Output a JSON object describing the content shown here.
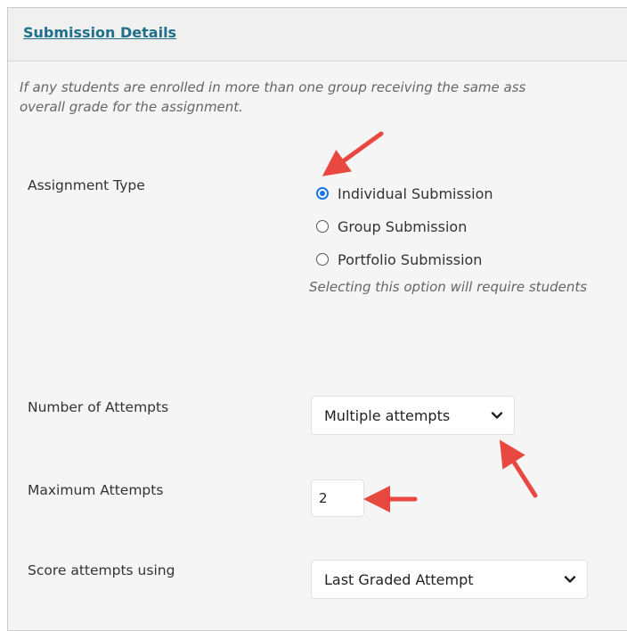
{
  "panel": {
    "title": "Submission Details",
    "intro_line1": "If any students are enrolled in more than one group receiving the same ass",
    "intro_line2": "overall grade for the assignment."
  },
  "assignment_type": {
    "label": "Assignment Type",
    "options": [
      {
        "label": "Individual Submission",
        "checked": true
      },
      {
        "label": "Group Submission",
        "checked": false
      },
      {
        "label": "Portfolio Submission",
        "checked": false
      }
    ],
    "helper": "Selecting this option will require students"
  },
  "attempts": {
    "label": "Number of Attempts",
    "selected": "Multiple attempts"
  },
  "max_attempts": {
    "label": "Maximum Attempts",
    "value": "2"
  },
  "score_using": {
    "label": "Score attempts using",
    "selected": "Last Graded Attempt"
  },
  "colors": {
    "title": "#1f6f8b",
    "radio_accent": "#1a73e8",
    "annotation_arrow": "#e8483f"
  }
}
